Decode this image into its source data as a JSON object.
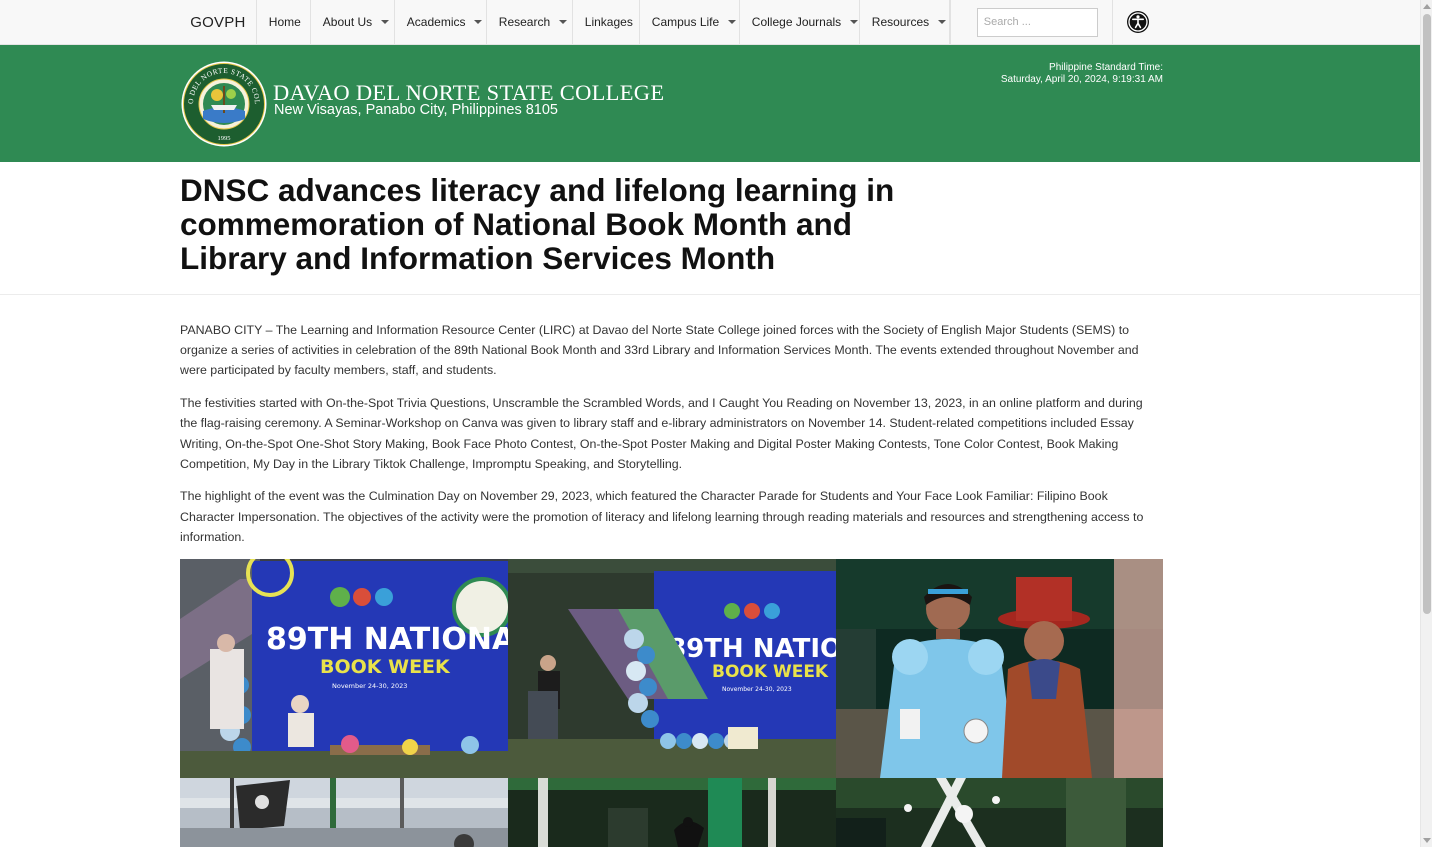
{
  "nav": {
    "brand": "GOVPH",
    "items": [
      {
        "label": "Home",
        "dropdown": false
      },
      {
        "label": "About Us",
        "dropdown": true
      },
      {
        "label": "Academics",
        "dropdown": true
      },
      {
        "label": "Research",
        "dropdown": true
      },
      {
        "label": "Linkages",
        "dropdown": false
      },
      {
        "label": "Campus Life",
        "dropdown": true
      },
      {
        "label": "College Journals",
        "dropdown": true
      },
      {
        "label": "Resources",
        "dropdown": true
      }
    ],
    "search_placeholder": "Search ...",
    "accessibility_icon": "accessibility-icon"
  },
  "header": {
    "college_name": "DAVAO DEL NORTE STATE COLLEGE",
    "address": "New Visayas, Panabo City, Philippines 8105",
    "seal_year": "1995",
    "seal_text": "DAVAO DEL NORTE STATE COLLEGE",
    "time_label": "Philippine Standard Time:",
    "time_value": "Saturday, April 20, 2024, 9:19:31 AM",
    "bg_color": "#2f8a53"
  },
  "article": {
    "title": "DNSC advances literacy and lifelong learning in commemoration of National Book Month and Library and Information Services Month",
    "paragraphs": [
      "PANABO CITY – The Learning and Information Resource Center (LIRC) at Davao del Norte State College joined forces with the Society of English Major Students (SEMS) to organize a series of activities in celebration of the 89th National Book Month and 33rd Library and Information Services Month. The events extended throughout November and were participated by faculty members, staff, and students.",
      "The festivities started with On-the-Spot Trivia Questions, Unscramble the Scrambled Words, and I Caught You Reading on November 13, 2023, in an online platform and during the flag-raising ceremony. A Seminar-Workshop on Canva was given to library staff and e-library administrators on November 14. Student-related competitions included Essay Writing, On-the-Spot One-Shot Story Making, Book Face Photo Contest, On-the-Spot Poster Making and Digital Poster Making Contests, Tone Color Contest, Book Making Competition, My Day in the Library Tiktok Challenge, Impromptu Speaking, and Storytelling.",
      "The highlight of the event was the Culmination Day on November 29, 2023, which featured the Character Parade for Students and Your Face Look Familiar: Filipino Book Character Impersonation. The objectives of the activity were the promotion of literacy and lifelong learning through reading materials and resources and strengthening access to information."
    ]
  },
  "gallery": {
    "banner_line1": "89TH NATIONA",
    "banner_line2": "BOOK WEEK",
    "banner_date": "November 24-30, 2023"
  }
}
